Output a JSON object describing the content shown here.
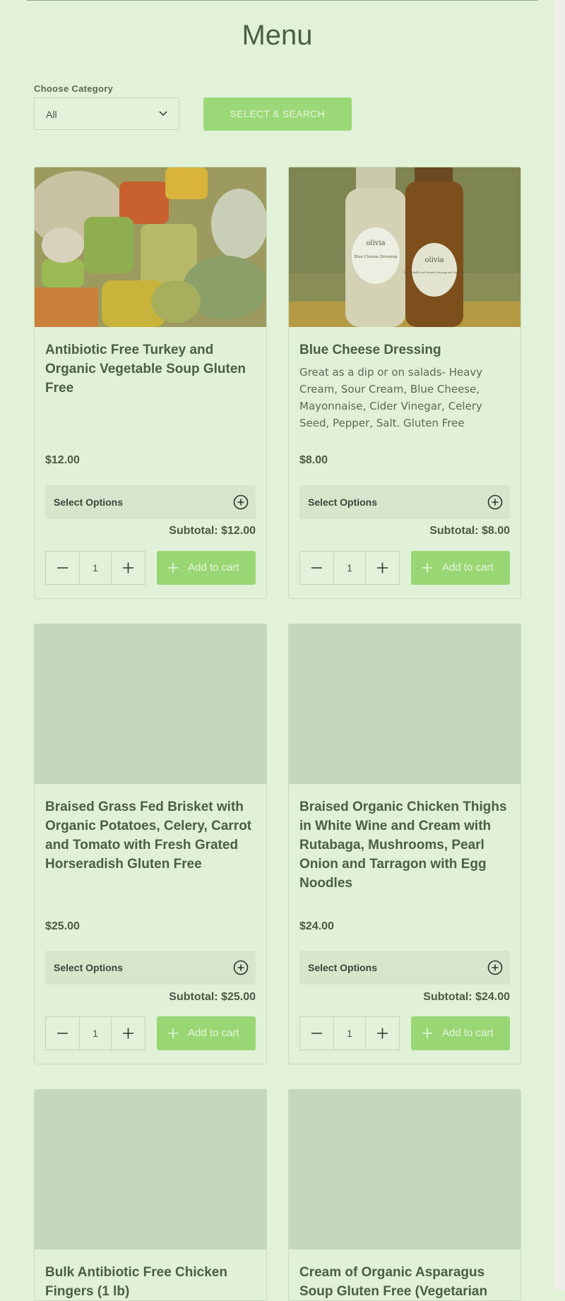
{
  "page": {
    "title": "Menu"
  },
  "filter": {
    "category_label": "Choose Category",
    "category_value": "All",
    "search_button": "SELECT & SEARCH"
  },
  "labels": {
    "select_options": "Select Options",
    "subtotal_prefix": "Subtotal:",
    "add_to_cart": "Add to cart"
  },
  "products": [
    {
      "name": "Antibiotic Free Turkey and Organic Vegetable Soup Gluten Free",
      "description": "",
      "price": "$12.00",
      "subtotal": "Subtotal: $12.00",
      "quantity": "1"
    },
    {
      "name": "Blue Cheese Dressing",
      "description": "Great as a dip or on salads- Heavy Cream, Sour Cream, Blue Cheese, Mayonnaise, Cider Vinegar, Celery Seed, Pepper, Salt. Gluten Free",
      "price": "$8.00",
      "subtotal": "Subtotal: $8.00",
      "quantity": "1"
    },
    {
      "name": "Braised Grass Fed Brisket with Organic Potatoes, Celery, Carrot and Tomato with Fresh Grated Horseradish Gluten Free",
      "description": "",
      "price": "$25.00",
      "subtotal": "Subtotal: $25.00",
      "quantity": "1"
    },
    {
      "name": "Braised Organic Chicken Thighs in White Wine and Cream with Rutabaga, Mushrooms, Pearl Onion and Tarragon with Egg Noodles",
      "description": "",
      "price": "$24.00",
      "subtotal": "Subtotal: $24.00",
      "quantity": "1"
    },
    {
      "name": "Bulk Antibiotic Free Chicken Fingers (1 lb)",
      "description": "",
      "price": "",
      "subtotal": "",
      "quantity": ""
    },
    {
      "name": "Cream of Organic Asparagus Soup Gluten Free (Vegetarian",
      "description": "",
      "price": "",
      "subtotal": "",
      "quantity": ""
    }
  ],
  "image_text": {
    "bottle1_brand": "olivia",
    "bottle1_label": "Blue Cheese Dressing",
    "bottle2_brand": "olivia",
    "bottle2_label": "Roast Shallot and Sesame Dressing and Marinade"
  },
  "colors": {
    "background": "#e2f2d8",
    "accent": "#9bd877",
    "title": "#4a6043",
    "image_placeholder": "#c4d8bf"
  }
}
